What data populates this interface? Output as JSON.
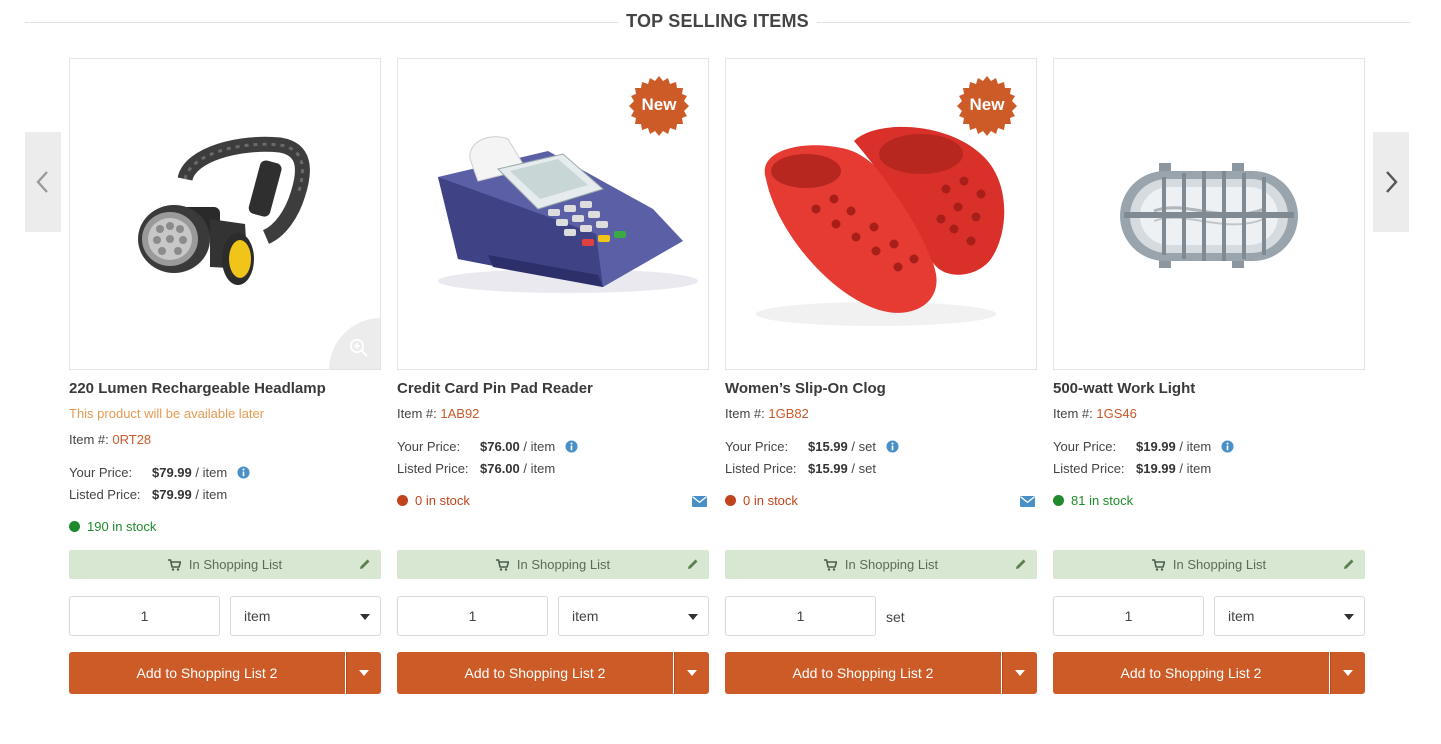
{
  "section": {
    "title": "TOP SELLING ITEMS"
  },
  "labels": {
    "item_no": "Item #:",
    "your_price": "Your Price:",
    "listed_price": "Listed Price:",
    "in_shopping_list": "In Shopping List",
    "add_button": "Add to Shopping List 2",
    "new_badge": "New"
  },
  "colors": {
    "accent": "#cd5b28",
    "in_list_bg": "#d7e7d1",
    "stock_in": "#1f8a2c",
    "stock_out": "#c0441d",
    "availability": "#e79a52",
    "info": "#4a90c8"
  },
  "products": [
    {
      "name": "220 Lumen Rechargeable Headlamp",
      "availability": "This product will be available later",
      "item_no": "0RT28",
      "your_price": "$79.99",
      "your_price_unit": " / item",
      "listed_price": "$79.99",
      "listed_price_unit": " / item",
      "stock": "190 in stock",
      "stock_status": "in",
      "is_new": false,
      "quantity": "1",
      "unit": "item",
      "unit_is_select": true,
      "image_icon": "headlamp-image"
    },
    {
      "name": "Credit Card Pin Pad Reader",
      "item_no": "1AB92",
      "your_price": "$76.00",
      "your_price_unit": " / item",
      "listed_price": "$76.00",
      "listed_price_unit": " / item",
      "stock": "0 in stock",
      "stock_status": "out",
      "is_new": true,
      "quantity": "1",
      "unit": "item",
      "unit_is_select": true,
      "image_icon": "card-reader-image"
    },
    {
      "name": "Women’s Slip-On Clog",
      "item_no": "1GB82",
      "your_price": "$15.99",
      "your_price_unit": " / set",
      "listed_price": "$15.99",
      "listed_price_unit": " / set",
      "stock": "0 in stock",
      "stock_status": "out",
      "is_new": true,
      "quantity": "1",
      "unit": "set",
      "unit_is_select": false,
      "image_icon": "clog-image"
    },
    {
      "name": "500-watt Work Light",
      "item_no": "1GS46",
      "your_price": "$19.99",
      "your_price_unit": " / item",
      "listed_price": "$19.99",
      "listed_price_unit": " / item",
      "stock": "81 in stock",
      "stock_status": "in",
      "is_new": false,
      "quantity": "1",
      "unit": "item",
      "unit_is_select": true,
      "image_icon": "work-light-image"
    }
  ]
}
